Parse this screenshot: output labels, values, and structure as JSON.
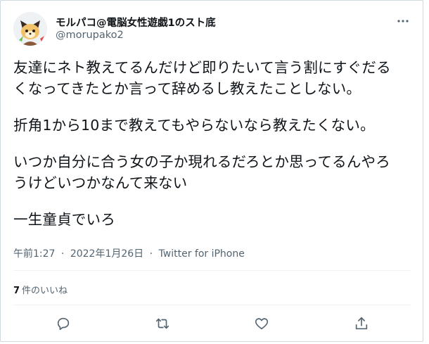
{
  "tweet": {
    "display_name": "モルパコ@電脳女性遊戯1のスト底",
    "handle": "@morupako2",
    "text_lines": [
      "友達にネト教えてるんだけど即りたいて言う割にすぐだる",
      "くなってきたとか言って辞めるし教えたことしない。",
      "",
      "折角1から10まで教えてもやらないなら教えたくない。",
      "",
      "いつか自分に合う女の子か現れるだろとか思ってるんやろ",
      "うけどいつかなんて来ない",
      "",
      "一生童貞でいろ"
    ],
    "time": "午前1:27",
    "date": "2022年1月26日",
    "separator": "·",
    "source": "Twitter for iPhone",
    "likes_count": "7",
    "likes_label": "件のいいね"
  },
  "icons": {
    "more": "more-icon",
    "reply": "reply-icon",
    "retweet": "retweet-icon",
    "like": "heart-icon",
    "share": "share-icon"
  },
  "colors": {
    "text_primary": "#0f1419",
    "text_secondary": "#536471",
    "border": "#cfd9de"
  }
}
